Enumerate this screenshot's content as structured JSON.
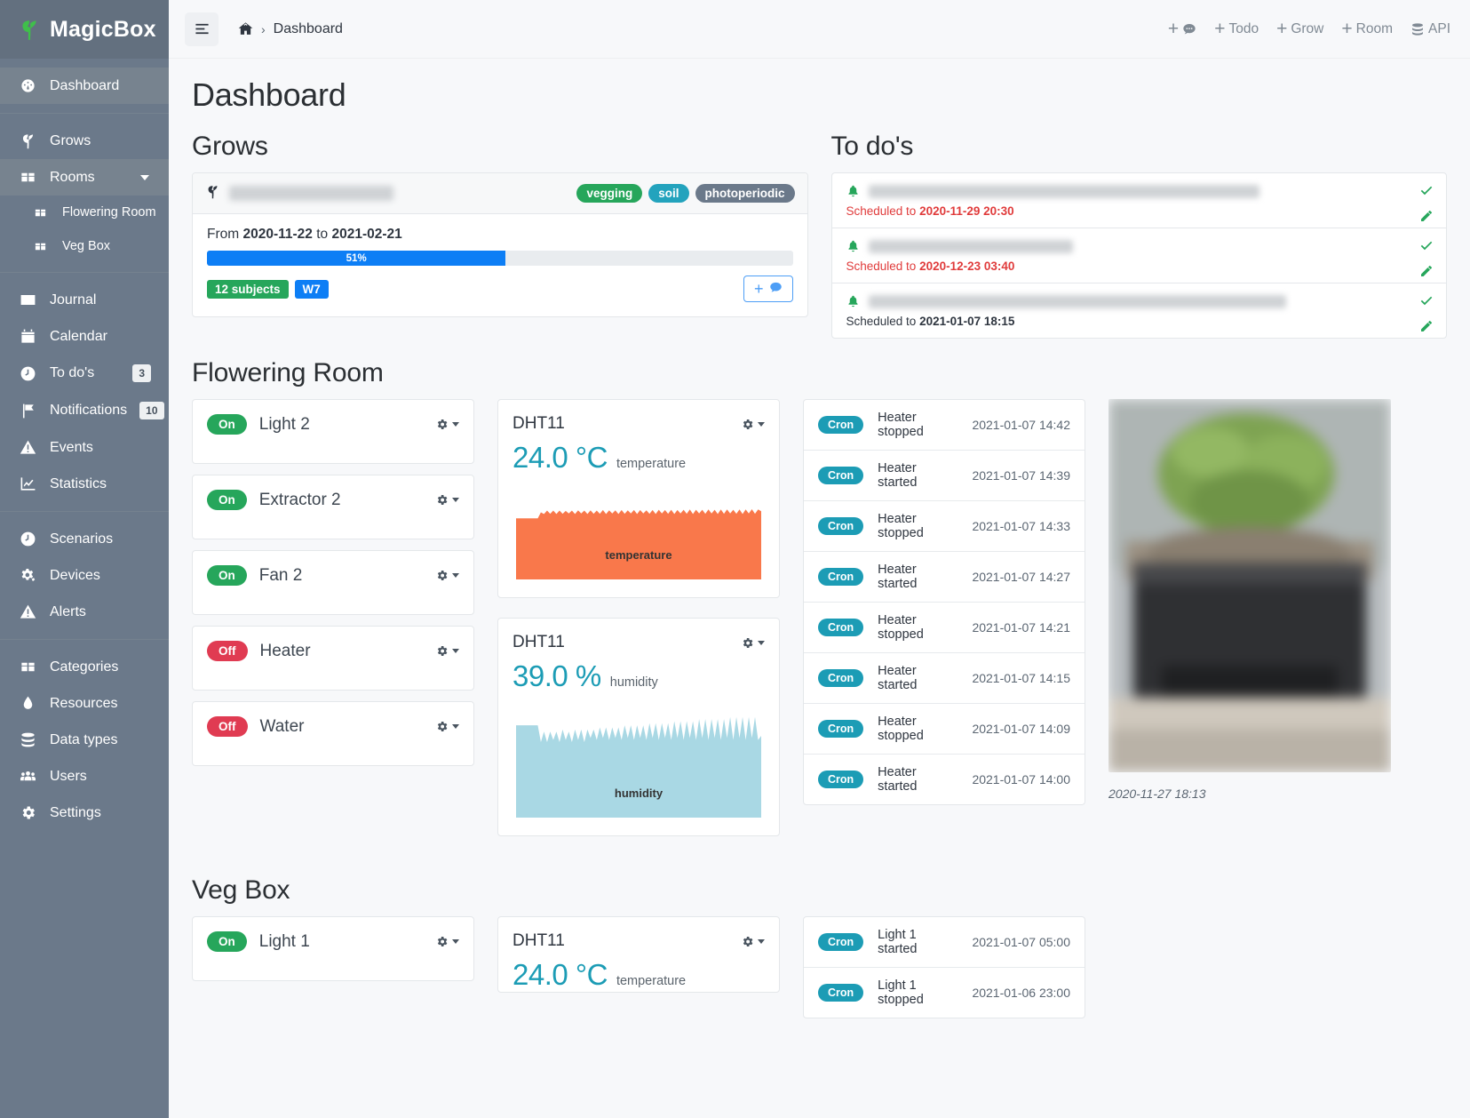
{
  "brand": {
    "name": "MagicBox",
    "logo_icon": "sprout-icon"
  },
  "sidebar": {
    "groups": [
      {
        "items": [
          {
            "label": "Dashboard",
            "icon": "dashboard-icon",
            "active": true
          }
        ]
      },
      {
        "items": [
          {
            "label": "Grows",
            "icon": "sprout-icon"
          },
          {
            "label": "Rooms",
            "icon": "box-icon",
            "expandable": true
          },
          {
            "label": "Flowering Room",
            "icon": "box-icon",
            "sub": true
          },
          {
            "label": "Veg Box",
            "icon": "box-icon",
            "sub": true
          }
        ]
      },
      {
        "items": [
          {
            "label": "Journal",
            "icon": "journal-icon"
          },
          {
            "label": "Calendar",
            "icon": "calendar-icon"
          },
          {
            "label": "To do's",
            "icon": "clock-icon",
            "badge": "3"
          },
          {
            "label": "Notifications",
            "icon": "flag-icon",
            "badge": "10"
          },
          {
            "label": "Events",
            "icon": "warning-icon"
          },
          {
            "label": "Statistics",
            "icon": "chart-icon"
          }
        ]
      },
      {
        "items": [
          {
            "label": "Scenarios",
            "icon": "clock-icon"
          },
          {
            "label": "Devices",
            "icon": "gears-icon"
          },
          {
            "label": "Alerts",
            "icon": "warning-icon"
          }
        ]
      },
      {
        "items": [
          {
            "label": "Categories",
            "icon": "box-icon"
          },
          {
            "label": "Resources",
            "icon": "droplet-icon"
          },
          {
            "label": "Data types",
            "icon": "database-icon"
          },
          {
            "label": "Users",
            "icon": "users-icon"
          },
          {
            "label": "Settings",
            "icon": "gear-icon"
          }
        ]
      }
    ]
  },
  "topbar": {
    "menu_icon": "hamburger-icon",
    "breadcrumb": {
      "home_icon": "home-icon",
      "separator": "›",
      "current": "Dashboard"
    },
    "actions": [
      {
        "label": "",
        "icon": "comment-icon",
        "plus": true
      },
      {
        "label": "Todo",
        "icon": "",
        "plus": true
      },
      {
        "label": "Grow",
        "icon": "",
        "plus": true
      },
      {
        "label": "Room",
        "icon": "",
        "plus": true
      },
      {
        "label": "API",
        "icon": "database-icon",
        "plus": false
      }
    ]
  },
  "page": {
    "title": "Dashboard"
  },
  "grows": {
    "heading": "Grows",
    "card": {
      "icon": "sprout-icon",
      "name_redacted": true,
      "tags": [
        {
          "label": "vegging",
          "color": "#26a65b"
        },
        {
          "label": "soil",
          "color": "#23a3bd"
        },
        {
          "label": "photoperiodic",
          "color": "#6b798a"
        }
      ],
      "from_label": "From",
      "from_date": "2020-11-22",
      "to_label": "to",
      "to_date": "2021-02-21",
      "progress_percent": 51,
      "progress_text": "51%",
      "subjects_badge": "12 subjects",
      "week_badge": "W7",
      "add_button": {
        "plus": "+",
        "icon": "comment-icon"
      }
    }
  },
  "todos": {
    "heading": "To do's",
    "items": [
      {
        "bell_icon": "bell-icon",
        "text_redacted": true,
        "schedule_prefix": "Scheduled to",
        "schedule_date": "2020-11-29 20:30",
        "overdue": true,
        "check_icon": "check-icon",
        "edit_icon": "edit-icon"
      },
      {
        "bell_icon": "bell-icon",
        "text_redacted": true,
        "schedule_prefix": "Scheduled to",
        "schedule_date": "2020-12-23 03:40",
        "overdue": true,
        "check_icon": "check-icon",
        "edit_icon": "edit-icon"
      },
      {
        "bell_icon": "bell-icon",
        "text_redacted": true,
        "schedule_prefix": "Scheduled to",
        "schedule_date": "2021-01-07 18:15",
        "overdue": false,
        "check_icon": "check-icon",
        "edit_icon": "edit-icon"
      }
    ]
  },
  "rooms": [
    {
      "name": "Flowering Room",
      "devices": [
        {
          "name": "Light 2",
          "state": "On"
        },
        {
          "name": "Extractor 2",
          "state": "On"
        },
        {
          "name": "Fan 2",
          "state": "On"
        },
        {
          "name": "Heater",
          "state": "Off"
        },
        {
          "name": "Water",
          "state": "Off"
        }
      ],
      "sensors": [
        {
          "title": "DHT11",
          "value": "24.0",
          "unit": "°C",
          "metric": "temperature",
          "chart_label": "temperature",
          "color": "#f9784b"
        },
        {
          "title": "DHT11",
          "value": "39.0",
          "unit": "%",
          "metric": "humidity",
          "chart_label": "humidity",
          "color": "#a9d8e4"
        }
      ],
      "events": [
        {
          "source": "Cron",
          "message": "Heater stopped",
          "time": "2021-01-07 14:42"
        },
        {
          "source": "Cron",
          "message": "Heater started",
          "time": "2021-01-07 14:39"
        },
        {
          "source": "Cron",
          "message": "Heater stopped",
          "time": "2021-01-07 14:33"
        },
        {
          "source": "Cron",
          "message": "Heater started",
          "time": "2021-01-07 14:27"
        },
        {
          "source": "Cron",
          "message": "Heater stopped",
          "time": "2021-01-07 14:21"
        },
        {
          "source": "Cron",
          "message": "Heater started",
          "time": "2021-01-07 14:15"
        },
        {
          "source": "Cron",
          "message": "Heater stopped",
          "time": "2021-01-07 14:09"
        },
        {
          "source": "Cron",
          "message": "Heater started",
          "time": "2021-01-07 14:00"
        }
      ],
      "photo_caption": "2020-11-27 18:13"
    },
    {
      "name": "Veg Box",
      "devices": [
        {
          "name": "Light 1",
          "state": "On"
        }
      ],
      "sensors": [
        {
          "title": "DHT11",
          "value": "24.0",
          "unit": "°C",
          "metric": "temperature",
          "chart_label": "temperature",
          "color": "#f9784b"
        }
      ],
      "events": [
        {
          "source": "Cron",
          "message": "Light 1 started",
          "time": "2021-01-07 05:00"
        },
        {
          "source": "Cron",
          "message": "Light 1 stopped",
          "time": "2021-01-06 23:00"
        }
      ]
    }
  ],
  "chart_data": [
    {
      "type": "area",
      "title": "temperature",
      "ylabel": "°C",
      "color": "#f9784b",
      "current_value": 24.0,
      "ylim": [
        0,
        30
      ],
      "values": [
        21.5,
        21.5,
        21.5,
        21.5,
        21.5,
        21.5,
        21.5,
        21.5,
        23.6,
        23.0,
        24.2,
        23.1,
        24.2,
        23.0,
        24.2,
        23.1,
        24.1,
        23.2,
        24.2,
        23.0,
        24.3,
        23.2,
        24.2,
        23.0,
        24.3,
        23.1,
        24.2,
        23.1,
        24.4,
        23.0,
        24.3,
        23.2,
        24.3,
        23.0,
        24.4,
        23.1,
        24.3,
        23.2,
        24.4,
        23.0,
        24.4,
        23.2,
        24.3,
        23.1,
        24.4,
        23.0,
        24.5,
        23.2,
        24.4,
        23.1,
        24.5,
        23.0,
        24.4,
        23.2,
        24.5,
        23.1,
        24.6,
        23.0,
        24.5,
        23.2,
        24.5,
        23.1,
        24.6,
        23.2,
        24.5,
        23.0,
        24.6,
        23.1,
        24.6,
        23.2,
        24.5,
        23.1,
        24.6,
        23.0,
        24.6,
        23.2,
        24.7,
        23.1,
        24.6,
        24.0
      ]
    },
    {
      "type": "area",
      "title": "humidity",
      "ylabel": "%",
      "color": "#a9d8e4",
      "current_value": 39.0,
      "ylim": [
        0,
        50
      ],
      "values": [
        44,
        44,
        44,
        44,
        44,
        44,
        44,
        44,
        36,
        41,
        36,
        41,
        37,
        41,
        36,
        42,
        37,
        41,
        36,
        42,
        37,
        42,
        36,
        42,
        38,
        42,
        37,
        43,
        38,
        43,
        37,
        43,
        38,
        43,
        37,
        44,
        38,
        44,
        37,
        44,
        38,
        44,
        37,
        45,
        38,
        45,
        37,
        45,
        38,
        45,
        37,
        46,
        38,
        46,
        37,
        46,
        38,
        46,
        37,
        47,
        38,
        47,
        37,
        47,
        38,
        47,
        37,
        47,
        38,
        48,
        37,
        48,
        38,
        48,
        37,
        48,
        38,
        48,
        37,
        39
      ]
    }
  ]
}
